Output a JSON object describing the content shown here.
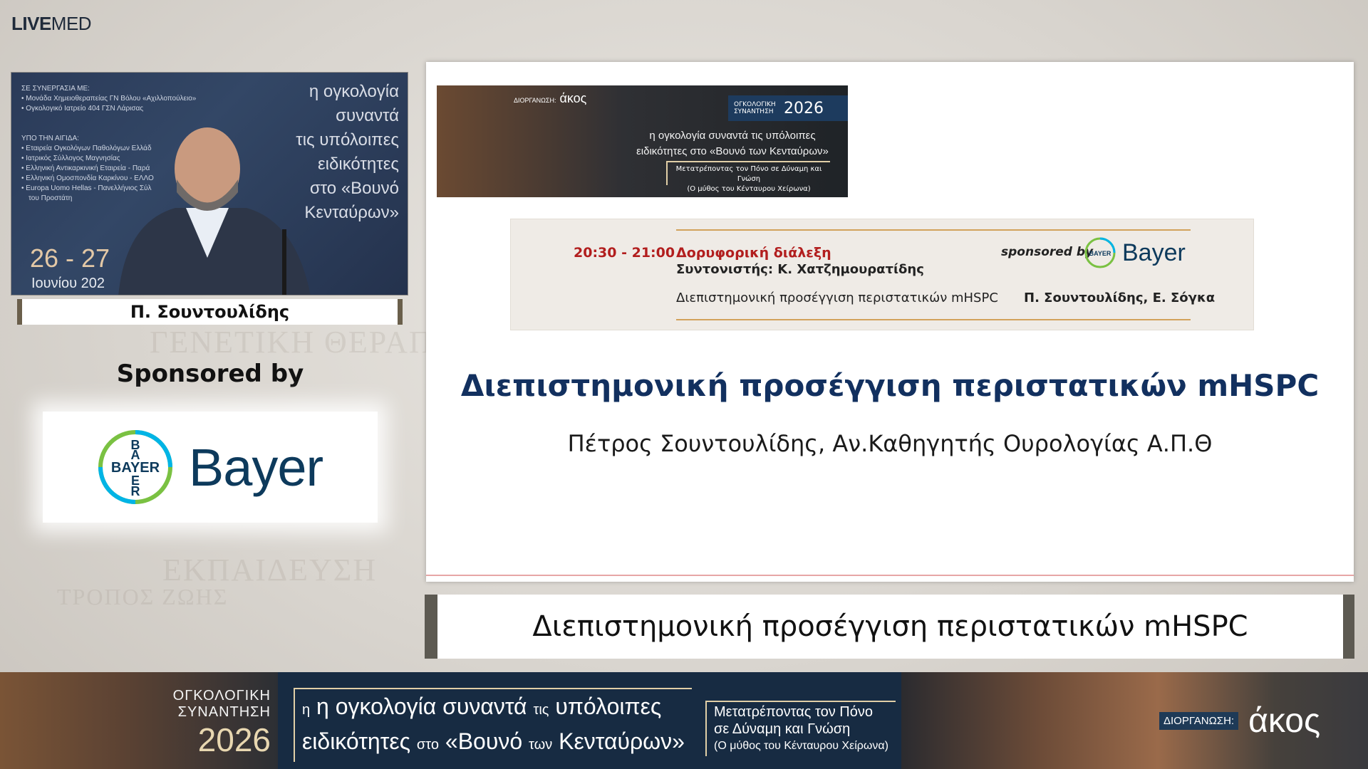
{
  "brand": {
    "bold": "LIVE",
    "light": "MED"
  },
  "video": {
    "partners_heading": "ΣΕ ΣΥΝΕΡΓΑΣΙΑ ΜΕ:",
    "partners": [
      "Μονάδα Χημειοθεραπείας ΓΝ Βόλου «Αχιλλοπούλειο»",
      "Ογκολογικό Ιατρείο 404 ΓΣΝ Λάρισας"
    ],
    "aegis_heading": "ΥΠΟ ΤΗΝ ΑΙΓΙΔΑ:",
    "aegis": [
      "Εταιρεία Ογκολόγων Παθολόγων Ελλάδ",
      "Ιατρικός Σύλλογος Μαγνησίας",
      "Ελληνική Αντικαρκινική Εταιρεία - Παρά",
      "Ελληνική Ομοσπονδία Καρκίνου - ΕΛΛΟ",
      "Europa Uomo Hellas - Πανελλήνιος Σύλ",
      "του Προστάτη"
    ],
    "right_lines": [
      "η ογκολογία",
      "συναντά",
      "τις υπόλοιπες",
      "ειδικότητες",
      "στο «Βουνό",
      "Κενταύρων»"
    ],
    "dates": "26 - 27",
    "month": "Ιουνίου 202"
  },
  "speaker_name": "Π. Σουντουλίδης",
  "sponsor": {
    "label": "Sponsored by",
    "brand": "Bayer",
    "logo_letters": "BAYER",
    "brand_color": "#0d3a5c",
    "ring_color_1": "#7ac142",
    "ring_color_2": "#00b4e6"
  },
  "slide": {
    "banner": {
      "organizer": "ΔΙΟΡΓΑΝΩΣΗ:",
      "organizer_logo": "άκος",
      "meeting_label": "ΟΓΚΟΛΟΓΙΚΗ ΣΥΝΑΝΤΗΣΗ",
      "year": "2026",
      "line1": "η ογκολογία συναντά τις υπόλοιπες",
      "line2": "ειδικότητες στο «Βουνό των Κενταύρων»",
      "sub1": "Μετατρέποντας τον Πόνο σε Δύναμη και Γνώση",
      "sub2": "(Ο μύθος του Κένταυρου Χείρωνα)"
    },
    "schedule": {
      "time": "20:30 - 21:00",
      "title": "Δορυφορική διάλεξη",
      "coordinator": "Συντονιστής: Κ. Χατζημουρατίδης",
      "sponsored_by": "sponsored by",
      "sponsor_name": "Bayer",
      "topic": "Διεπιστημονική προσέγγιση περιστατικών mHSPC",
      "speakers": "Π. Σουντουλίδης, Ε. Σόγκα"
    },
    "title": "Διεπιστημονική προσέγγιση περιστατικών mHSPC",
    "subtitle": "Πέτρος Σουντουλίδης, Αν.Καθηγητής Ουρολογίας Α.Π.Θ"
  },
  "lower_third": "Διεπιστημονική προσέγγιση περιστατικών mHSPC",
  "strip": {
    "meeting_line1": "ΟΓΚΟΛΟΓΙΚΗ",
    "meeting_line2": "ΣΥΝΑΝΤΗΣΗ",
    "year": "2026",
    "tagline_1a": "η ογκολογία συναντά",
    "tagline_1b": "τις",
    "tagline_1c": "υπόλοιπες",
    "tagline_2a": "ειδικότητες",
    "tagline_2b": "στο",
    "tagline_2c": "«Βουνό",
    "tagline_2d": "των",
    "tagline_2e": "Κενταύρων»",
    "sub1": "Μετατρέποντας τον Πόνο",
    "sub2": "σε Δύναμη και Γνώση",
    "sub3": "(Ο μύθος του Κένταυρου Χείρωνα)",
    "organizer_label": "ΔΙΟΡΓΑΝΩΣΗ:",
    "organizer_logo": "άκος"
  },
  "background_words": [
    "ΓΕΝΕΤΙΚΗ ΘΕΡΑΠΕΙΑ",
    "ΕΚΠΑΙΔΕΥΣΗ",
    "ΤΡΟΠΟΣ ΖΩΗΣ"
  ]
}
